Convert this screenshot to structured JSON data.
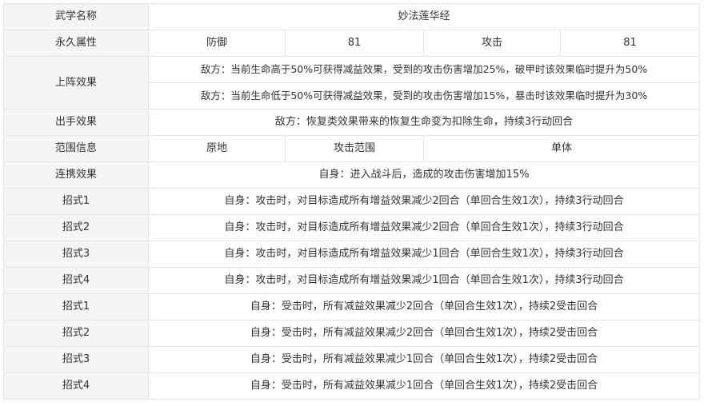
{
  "table": {
    "row_name": {
      "label": "武学名称",
      "value": "妙法莲华经"
    },
    "row_attr": {
      "label": "永久属性",
      "cells": [
        "防御",
        "81",
        "攻击",
        "81"
      ]
    },
    "row_deploy": {
      "label": "上阵效果",
      "lines": [
        "敌方：当前生命高于50%可获得减益效果，受到的攻击伤害增加25%，破甲时该效果临时提升为50%",
        "敌方：当前生命低于50%可获得减益效果，受到的攻击伤害增加15%，暴击时该效果临时提升为30%"
      ]
    },
    "row_strike": {
      "label": "出手效果",
      "value": "敌方：恢复类效果带来的恢复生命变为扣除生命，持续3行动回合"
    },
    "row_range": {
      "label": "范围信息",
      "cells": [
        "原地",
        "攻击范围",
        "单体"
      ]
    },
    "row_combo": {
      "label": "连携效果",
      "value": "自身：进入战斗后，造成的攻击伤害增加15%"
    },
    "moves": [
      {
        "label": "招式1",
        "value": "自身：攻击时，对目标造成所有增益效果减少2回合（单回合生效1次），持续3行动回合"
      },
      {
        "label": "招式2",
        "value": "自身：攻击时，对目标造成所有增益效果减少2回合（单回合生效1次），持续3行动回合"
      },
      {
        "label": "招式3",
        "value": "自身：攻击时，对目标造成所有增益效果减少1回合（单回合生效1次），持续3行动回合"
      },
      {
        "label": "招式4",
        "value": "自身：攻击时，对目标造成所有增益效果减少1回合（单回合生效1次），持续3行动回合"
      },
      {
        "label": "招式1",
        "value": "自身：受击时，所有减益效果减少2回合（单回合生效1次），持续2受击回合"
      },
      {
        "label": "招式2",
        "value": "自身：受击时，所有减益效果减少2回合（单回合生效1次），持续2受击回合"
      },
      {
        "label": "招式3",
        "value": "自身：受击时，所有减益效果减少1回合（单回合生效1次），持续2受击回合"
      },
      {
        "label": "招式4",
        "value": "自身：受击时，所有减益效果减少1回合（单回合生效1次），持续2受击回合"
      }
    ]
  }
}
